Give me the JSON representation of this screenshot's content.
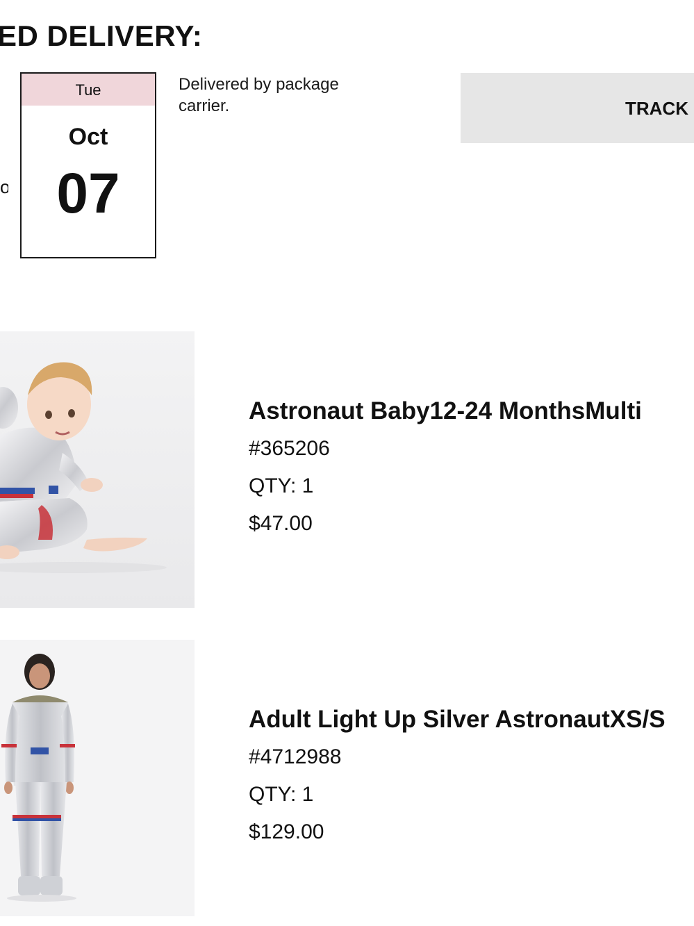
{
  "header": {
    "title": "ED DELIVERY:",
    "cut_glyph": "o"
  },
  "delivery": {
    "day": "Tue",
    "month": "Oct",
    "date": "07",
    "note": "Delivered by package carrier.",
    "track_label": "TRACK"
  },
  "items": [
    {
      "name": "Astronaut Baby12-24 MonthsMulti",
      "sku": "#365206",
      "qty": "QTY: 1",
      "price": "$47.00",
      "image_icon": "baby-astronaut-costume-photo"
    },
    {
      "name": "Adult Light Up Silver AstronautXS/S",
      "sku": "#4712988",
      "qty": "QTY: 1",
      "price": "$129.00",
      "image_icon": "adult-astronaut-costume-photo"
    }
  ],
  "colors": {
    "calendar_header": "#f0d6da",
    "button_bg": "#e6e6e6",
    "text": "#111111"
  }
}
